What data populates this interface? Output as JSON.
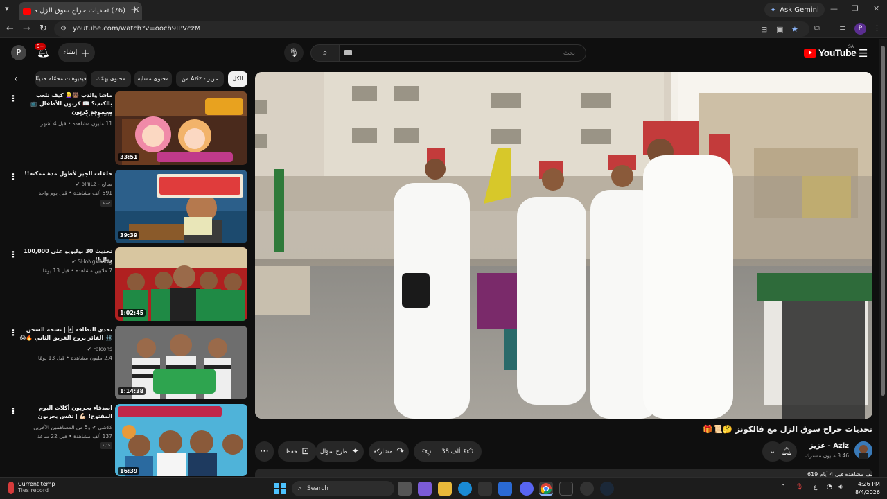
{
  "browser": {
    "tab_title": "(76) تحديات حراج سوق الزل مع فا",
    "url": "youtube.com/watch?v=ooch9IPVczM",
    "ask_gemini": "Ask Gemini",
    "profile_initial": "P"
  },
  "header": {
    "avatar_initial": "P",
    "notification_count": "9+",
    "create_label": "إنشاء",
    "search_placeholder": "بحث",
    "logo_text": "YouTube",
    "region": "SA"
  },
  "chips": [
    "الكل",
    "من Aziz - عزيز",
    "محتوى مشابه",
    "محتوى يهمّك",
    "فيديوهات محمّلة حديثًا"
  ],
  "recommendations": [
    {
      "title": "ماشا والدب 🐻👱‍♀️ كيف نلعب بالكتب؟ 📖 كرتون للأطفال 📺 مجموعة كرتون",
      "channel": "ماشا و الدب ✔",
      "meta": "11 مليون مشاهدة • قبل 4 أشهر",
      "duration": "33:51",
      "badge": ""
    },
    {
      "title": "حلقات الجير لأطول مدة ممكنة!!",
      "channel": "صالح - oPiiLz ✔",
      "meta": "591 ألف مشاهدة • قبل يوم واحد",
      "duration": "39:39",
      "badge": "جديد"
    },
    {
      "title": "تحديث 30 بوليويو على 100,000 ريال!!",
      "channel": "SHoNgxBoNg ✔",
      "meta": "7 ملايين مشاهدة • قبل 13 يومًا",
      "duration": "1:02:45",
      "badge": ""
    },
    {
      "title": "تحدي البطاقة 🃏 | نسخة السجن ⛓️ الفائز يروح الفريق الثاني 🔥😱",
      "channel": "Falcons ✔",
      "meta": "2.4 مليون مشاهدة • قبل 13 يومًا",
      "duration": "1:14:38",
      "badge": ""
    },
    {
      "title": "اصدقاء يجربون أكلات اليوم المفتوح! 💪🏻 | تفس يجربون",
      "channel": "كلاشي ✔ و5 من المساهمين الآخرين",
      "meta": "137 ألف مشاهدة • قبل 22 ساعة",
      "duration": "16:39",
      "badge": "جديد"
    }
  ],
  "video": {
    "title": "تحديات حراج سوق الزل مع فالكونز 🤔📜🎁",
    "channel_name": "Aziz - عزيز",
    "subscribers": "3.46 مليون مشترك",
    "likes": "38 ألف",
    "share": "مشاركة",
    "ask": "طرح سؤال",
    "save": "حفظ",
    "description_peek": "619 ألف مشاهدة قبل 4 أيام"
  },
  "taskbar": {
    "weather_title": "Current temp",
    "weather_sub": "Ties record",
    "search_label": "Search",
    "time": "4:26 PM",
    "date": "8/4/2026",
    "lang": "ع"
  }
}
